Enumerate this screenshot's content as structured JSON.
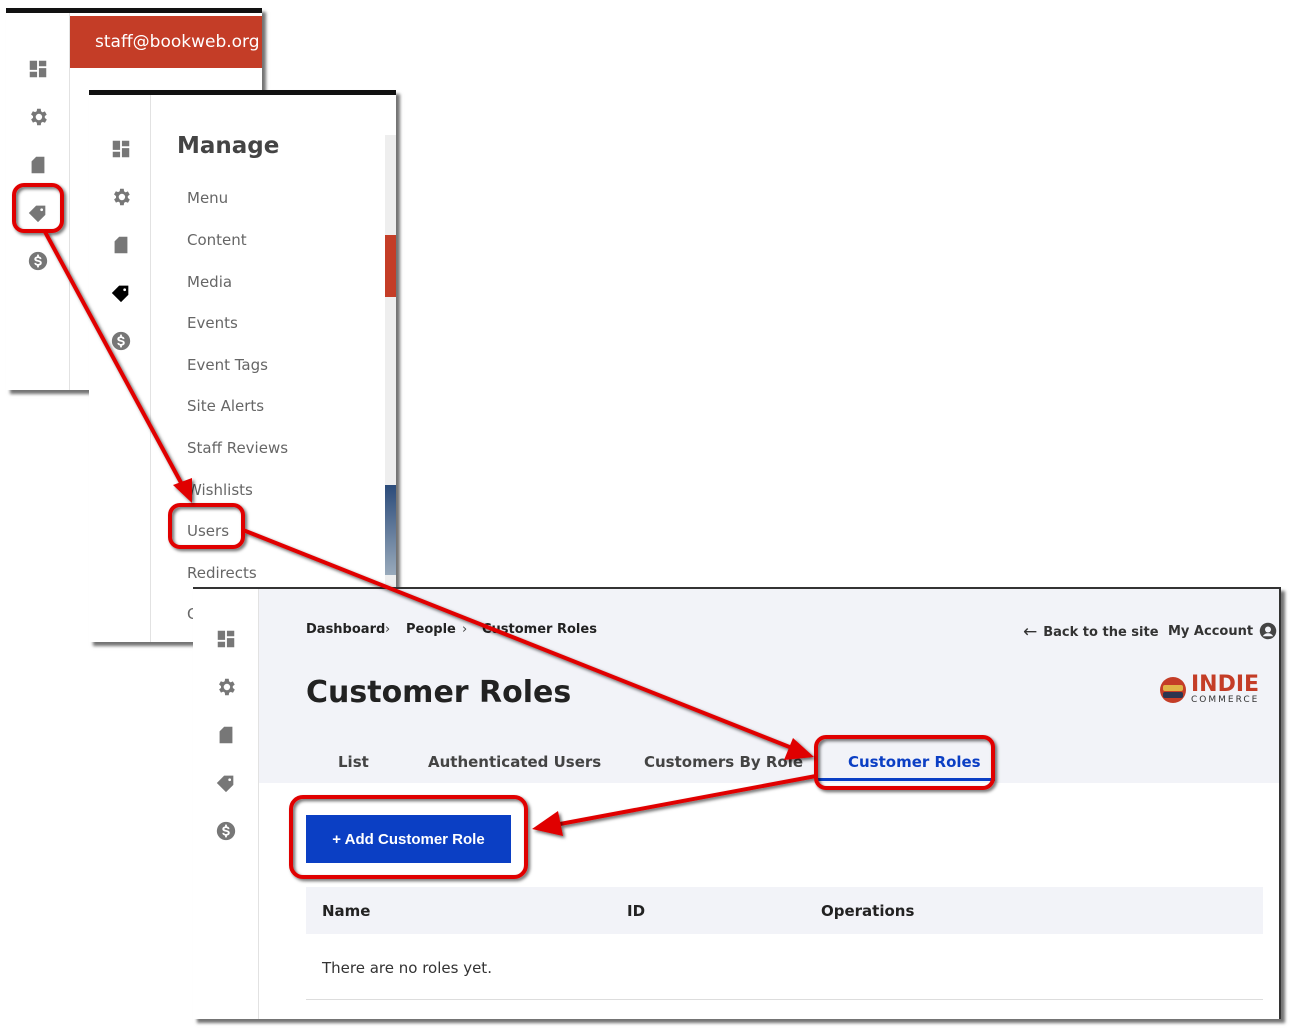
{
  "panel1": {
    "email": "staff@bookweb.org"
  },
  "panel2": {
    "title": "Manage",
    "items": [
      "Menu",
      "Content",
      "Media",
      "Events",
      "Event Tags",
      "Site Alerts",
      "Staff Reviews",
      "Wishlists",
      "Users",
      "Redirects",
      "C"
    ]
  },
  "panel3": {
    "breadcrumb": [
      "Dashboard",
      "People",
      "Customer Roles"
    ],
    "breadcrumb_sep": "›",
    "back_label": "Back to the site",
    "account_label": "My Account",
    "logo": {
      "main": "INDIE",
      "sub": "COMMERCE"
    },
    "title": "Customer Roles",
    "tabs": [
      {
        "label": "List"
      },
      {
        "label": "Authenticated Users"
      },
      {
        "label": "Customers By Role"
      },
      {
        "label": "Customer Roles",
        "active": true
      }
    ],
    "add_button": "+ Add Customer Role",
    "table": {
      "columns": [
        "Name",
        "ID",
        "Operations"
      ],
      "empty": "There are no roles yet."
    }
  },
  "colors": {
    "accent": "#0b3fc4",
    "brand_red": "#c43d27",
    "annotation": "#e00000"
  },
  "icons": [
    "dashboard-icon",
    "gear-icon",
    "page-icon",
    "tag-icon",
    "dollar-icon"
  ]
}
